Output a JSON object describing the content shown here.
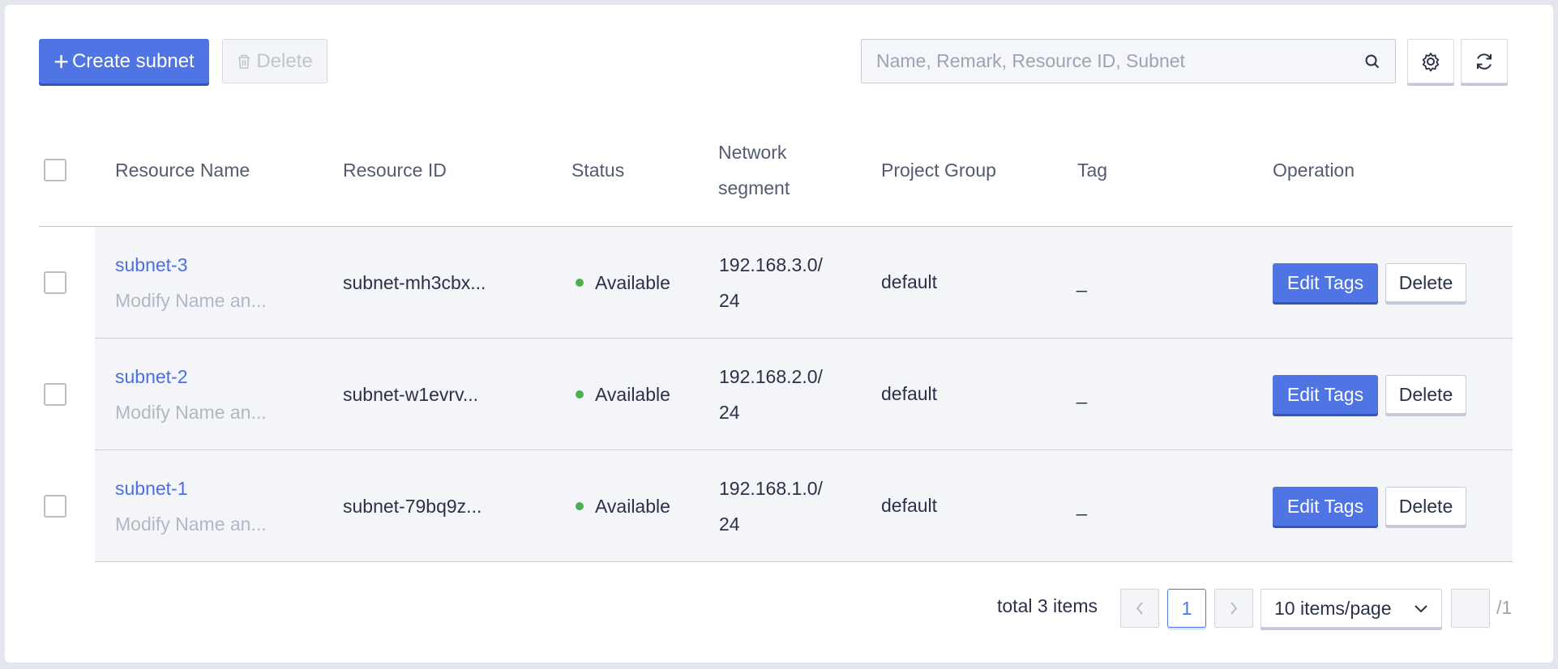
{
  "toolbar": {
    "create_label": "Create subnet",
    "delete_label": "Delete",
    "search_placeholder": "Name, Remark, Resource ID, Subnet"
  },
  "table": {
    "headers": {
      "name": "Resource Name",
      "id": "Resource ID",
      "status": "Status",
      "segment_line1": "Network",
      "segment_line2": "segment",
      "project": "Project Group",
      "tag": "Tag",
      "operation": "Operation"
    },
    "rows": [
      {
        "name": "subnet-3",
        "remark": "Modify Name an...",
        "id": "subnet-mh3cbx...",
        "status": "Available",
        "segment_line1": "192.168.3.0/",
        "segment_line2": "24",
        "project": "default",
        "tag": "_",
        "edit_label": "Edit Tags",
        "delete_label": "Delete"
      },
      {
        "name": "subnet-2",
        "remark": "Modify Name an...",
        "id": "subnet-w1evrv...",
        "status": "Available",
        "segment_line1": "192.168.2.0/",
        "segment_line2": "24",
        "project": "default",
        "tag": "_",
        "edit_label": "Edit Tags",
        "delete_label": "Delete"
      },
      {
        "name": "subnet-1",
        "remark": "Modify Name an...",
        "id": "subnet-79bq9z...",
        "status": "Available",
        "segment_line1": "192.168.1.0/",
        "segment_line2": "24",
        "project": "default",
        "tag": "_",
        "edit_label": "Edit Tags",
        "delete_label": "Delete"
      }
    ]
  },
  "pagination": {
    "total": "total 3 items",
    "current_page": "1",
    "page_size": "10 items/page",
    "of_pages": "/1"
  },
  "colors": {
    "primary": "#4f74e3",
    "status_available": "#4caf50"
  }
}
